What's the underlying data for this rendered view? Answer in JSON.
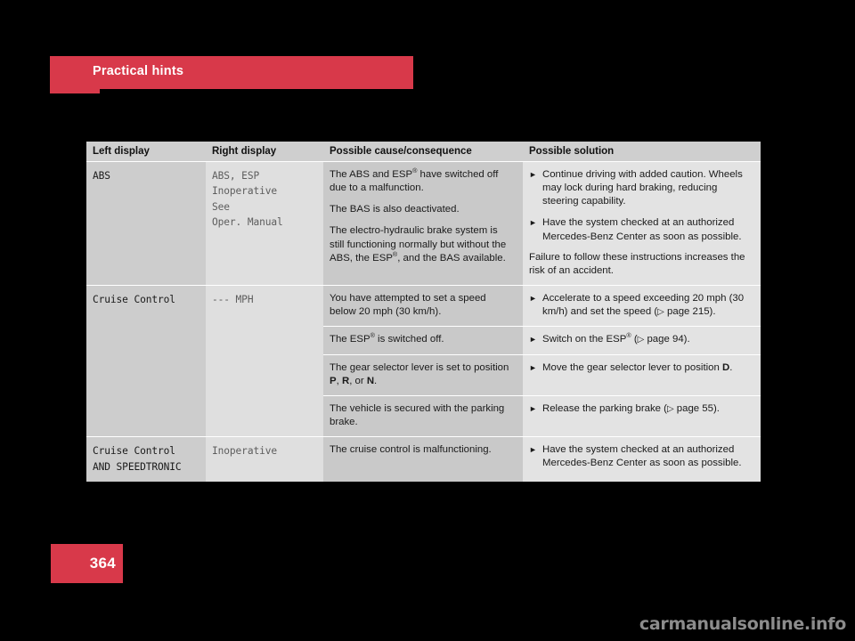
{
  "page": {
    "section_title": "Practical hints",
    "page_number": "364",
    "watermark": "carmanualsonline.info",
    "accent_color": "#d8394a"
  },
  "table": {
    "headers": [
      "Left display",
      "Right display",
      "Possible cause/consequence",
      "Possible solution"
    ],
    "rows": [
      {
        "left_display": "ABS",
        "right_display": "ABS, ESP\nInoperative\nSee\nOper. Manual",
        "cause_paragraphs": [
          "The ABS and ESP® have switched off due to a malfunction.",
          "The BAS is also deactivated.",
          "The electro-hydraulic brake system is still functioning normally but without the ABS, the ESP®, and the BAS available."
        ],
        "solution_steps": [
          "Continue driving with added caution. Wheels may lock during hard braking, reducing steering capability.",
          "Have the system checked at an authorized Mercedes-Benz Center as soon as possible."
        ],
        "solution_note": "Failure to follow these instructions increases the risk of an accident."
      },
      {
        "left_display": "Cruise Control",
        "right_display": "--- MPH",
        "sub_rows": [
          {
            "cause": "You have attempted to set a speed below 20 mph (30 km/h).",
            "solution_step": "Accelerate to a speed exceeding 20 mph (30 km/h) and set the speed (▷ page 215)."
          },
          {
            "cause": "The ESP® is switched off.",
            "solution_step": "Switch on the ESP® (▷ page 94)."
          },
          {
            "cause": "The gear selector lever is set to position P, R, or N.",
            "solution_step": "Move the gear selector lever to position D."
          },
          {
            "cause": "The vehicle is secured with the parking brake.",
            "solution_step": "Release the parking brake (▷ page 55)."
          }
        ]
      },
      {
        "left_display": "Cruise Control\nAND SPEEDTRONIC",
        "right_display": "Inoperative",
        "cause": "The cruise control is malfunctioning.",
        "solution_step": "Have the system checked at an authorized Mercedes-Benz Center as soon as possible."
      }
    ]
  }
}
